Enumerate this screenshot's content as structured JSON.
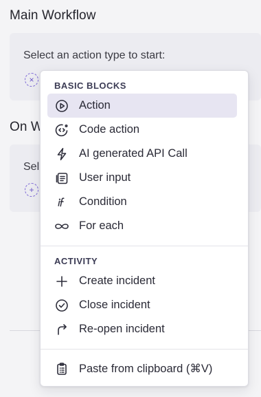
{
  "main_workflow": {
    "title": "Main Workflow",
    "prompt": "Select an action type to start:"
  },
  "on_section": {
    "title_partial": "On W",
    "prompt_partial": "Sel"
  },
  "menu": {
    "groups": [
      {
        "label": "BASIC BLOCKS",
        "items": [
          {
            "label": "Action",
            "icon": "play-circle-icon",
            "active": true
          },
          {
            "label": "Code action",
            "icon": "code-circle-icon"
          },
          {
            "label": "AI generated API Call",
            "icon": "lightning-icon"
          },
          {
            "label": "User input",
            "icon": "user-input-icon"
          },
          {
            "label": "Condition",
            "icon": "if-icon"
          },
          {
            "label": "For each",
            "icon": "loop-icon"
          }
        ]
      },
      {
        "label": "ACTIVITY",
        "items": [
          {
            "label": "Create incident",
            "icon": "plus-icon"
          },
          {
            "label": "Close incident",
            "icon": "check-circle-icon"
          },
          {
            "label": "Re-open incident",
            "icon": "redo-arrow-icon"
          }
        ]
      }
    ],
    "footer_item": {
      "label": "Paste from clipboard (⌘V)",
      "icon": "clipboard-icon"
    }
  },
  "colors": {
    "accent": "#7b66d6",
    "active_bg": "#e7e5f2"
  }
}
